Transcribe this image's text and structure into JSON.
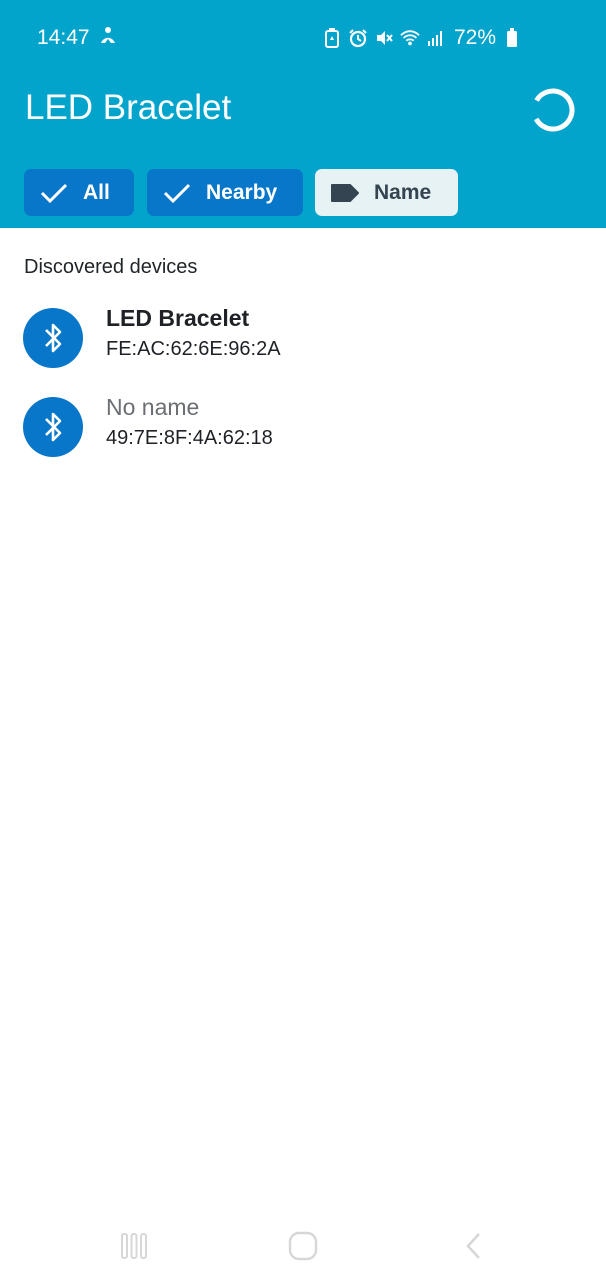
{
  "status_bar": {
    "time": "14:47",
    "battery": "72%"
  },
  "app": {
    "title": "LED Bracelet"
  },
  "filters": [
    {
      "label": "All",
      "icon": "check-icon",
      "selected": true
    },
    {
      "label": "Nearby",
      "icon": "check-icon",
      "selected": true
    },
    {
      "label": "Name",
      "icon": "label-tag-icon",
      "selected": false
    }
  ],
  "section": {
    "title": "Discovered devices"
  },
  "devices": [
    {
      "name": "LED Bracelet",
      "address": "FE:AC:62:6E:96:2A",
      "icon": "bluetooth-icon"
    },
    {
      "name": "No name",
      "address": "49:7E:8F:4A:62:18",
      "icon": "bluetooth-icon"
    }
  ],
  "colors": {
    "header": "#03A4CC",
    "chip_selected": "#0977C9",
    "chip_unselected": "#E6F2F4",
    "avatar": "#0977C9"
  }
}
